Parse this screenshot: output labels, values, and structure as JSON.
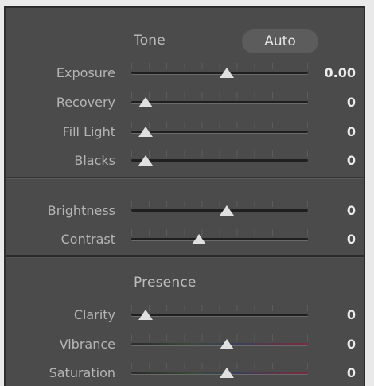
{
  "tone": {
    "title": "Tone",
    "auto_label": "Auto",
    "sliders": [
      {
        "label": "Exposure",
        "value": "0.00",
        "position": 0.5,
        "color_track": false
      },
      {
        "label": "Recovery",
        "value": "0",
        "position": 0.0,
        "color_track": false
      },
      {
        "label": "Fill Light",
        "value": "0",
        "position": 0.0,
        "color_track": false
      },
      {
        "label": "Blacks",
        "value": "0",
        "position": 0.0,
        "color_track": false
      }
    ],
    "sliders2": [
      {
        "label": "Brightness",
        "value": "0",
        "position": 0.5,
        "color_track": false
      },
      {
        "label": "Contrast",
        "value": "0",
        "position": 0.33,
        "color_track": false
      }
    ]
  },
  "presence": {
    "title": "Presence",
    "sliders": [
      {
        "label": "Clarity",
        "value": "0",
        "position": 0.0,
        "color_track": false
      },
      {
        "label": "Vibrance",
        "value": "0",
        "position": 0.5,
        "color_track": true
      },
      {
        "label": "Saturation",
        "value": "0",
        "position": 0.5,
        "color_track": true
      }
    ]
  },
  "colors": {
    "panel_bg": "#4b4b4b",
    "thumb": "#e0e0e0",
    "value_text": "#ececec"
  }
}
